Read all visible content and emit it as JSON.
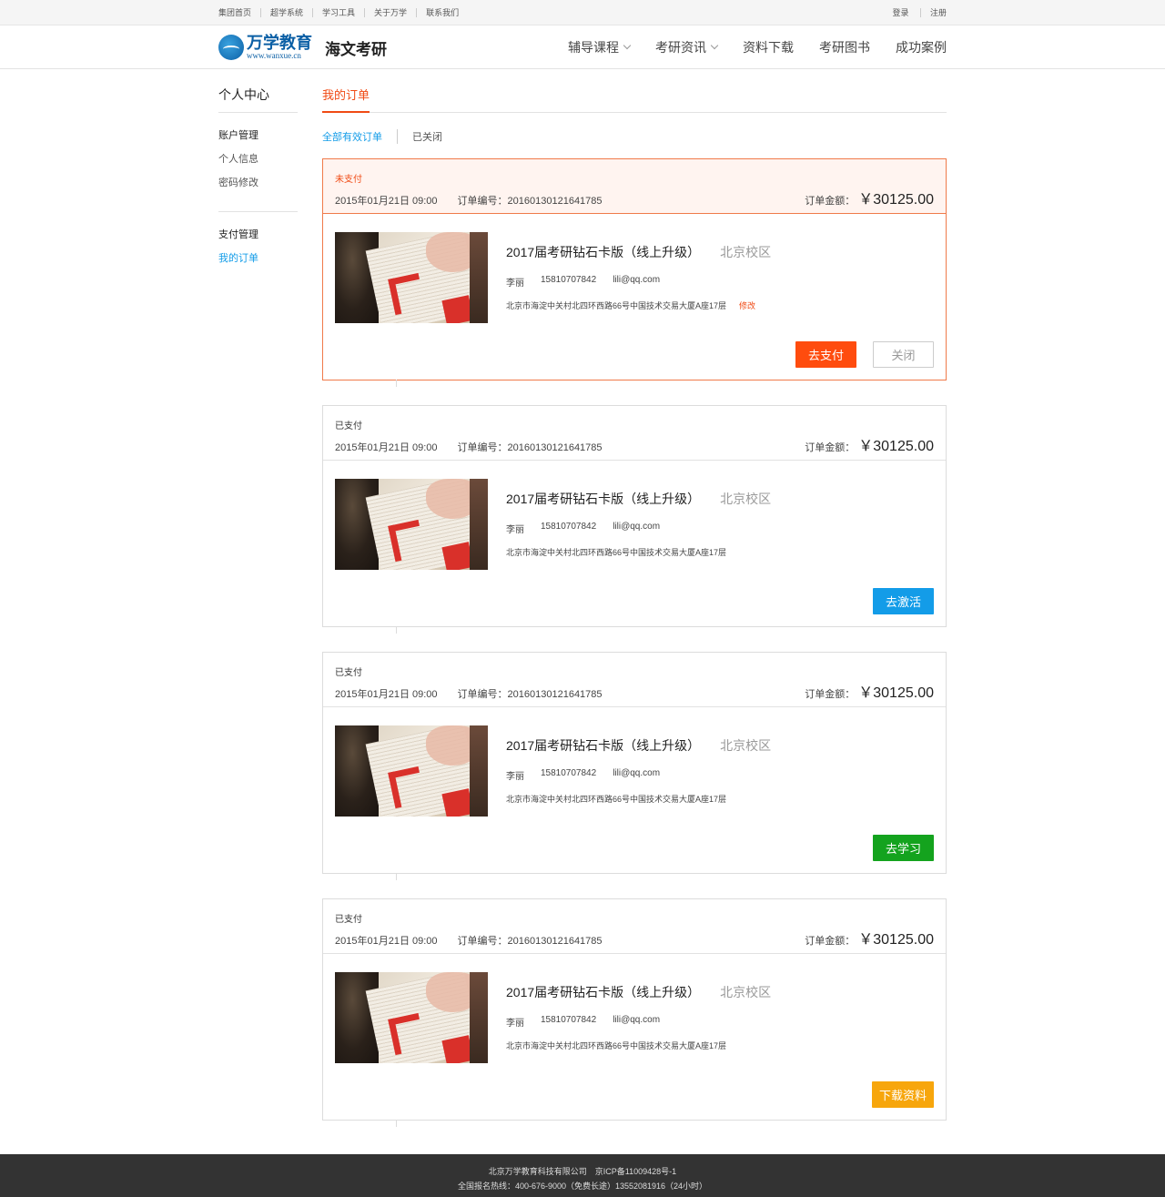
{
  "topbar": {
    "links": [
      "集团首页",
      "超学系统",
      "学习工具",
      "关于万学",
      "联系我们"
    ],
    "login": "登录",
    "register": "注册"
  },
  "header": {
    "logo_cn": "万学教育",
    "logo_en": "www.wanxue.cn",
    "brand_sub": "海文考研",
    "nav": [
      {
        "label": "辅导课程",
        "dropdown": true
      },
      {
        "label": "考研资讯",
        "dropdown": true
      },
      {
        "label": "资料下载",
        "dropdown": false
      },
      {
        "label": "考研图书",
        "dropdown": false
      },
      {
        "label": "成功案例",
        "dropdown": false
      }
    ]
  },
  "sidebar": {
    "title": "个人中心",
    "groups": [
      {
        "title": "账户管理",
        "items": [
          "个人信息",
          "密码修改"
        ]
      },
      {
        "title": "支付管理",
        "items": [
          "我的订单"
        ]
      }
    ],
    "active_item": "我的订单"
  },
  "main": {
    "tab": "我的订单",
    "filters": [
      "全部有效订单",
      "已关闭"
    ]
  },
  "orders": [
    {
      "status": "未支付",
      "date": "2015年01月21日 09:00",
      "order_no": "订单编号：20160130121641785",
      "amount_label": "订单金额：",
      "amount": "￥30125.00",
      "course": "2017届考研钻石卡版（线上升级）",
      "campus": "北京校区",
      "name": "李丽",
      "phone": "15810707842",
      "email": "lili@qq.com",
      "address": "北京市海淀中关村北四环西路66号中国技术交易大厦A座17层",
      "edit": "修改",
      "buttons": [
        {
          "label": "去支付",
          "style": "orange"
        },
        {
          "label": "关闭",
          "style": "ghost"
        }
      ]
    },
    {
      "status": "已支付",
      "date": "2015年01月21日 09:00",
      "order_no": "订单编号：20160130121641785",
      "amount_label": "订单金额：",
      "amount": "￥30125.00",
      "course": "2017届考研钻石卡版（线上升级）",
      "campus": "北京校区",
      "name": "李丽",
      "phone": "15810707842",
      "email": "lili@qq.com",
      "address": "北京市海淀中关村北四环西路66号中国技术交易大厦A座17层",
      "edit": "",
      "buttons": [
        {
          "label": "去激活",
          "style": "blue"
        }
      ]
    },
    {
      "status": "已支付",
      "date": "2015年01月21日 09:00",
      "order_no": "订单编号：20160130121641785",
      "amount_label": "订单金额：",
      "amount": "￥30125.00",
      "course": "2017届考研钻石卡版（线上升级）",
      "campus": "北京校区",
      "name": "李丽",
      "phone": "15810707842",
      "email": "lili@qq.com",
      "address": "北京市海淀中关村北四环西路66号中国技术交易大厦A座17层",
      "edit": "",
      "buttons": [
        {
          "label": "去学习",
          "style": "green"
        }
      ]
    },
    {
      "status": "已支付",
      "date": "2015年01月21日 09:00",
      "order_no": "订单编号：20160130121641785",
      "amount_label": "订单金额：",
      "amount": "￥30125.00",
      "course": "2017届考研钻石卡版（线上升级）",
      "campus": "北京校区",
      "name": "李丽",
      "phone": "15810707842",
      "email": "lili@qq.com",
      "address": "北京市海淀中关村北四环西路66号中国技术交易大厦A座17层",
      "edit": "",
      "buttons": [
        {
          "label": "下载资料",
          "style": "yellow"
        }
      ]
    }
  ],
  "footer": {
    "line1": "北京万学教育科技有限公司　京ICP备11009428号-1",
    "line2": "全国报名热线：400-676-9000（免费长途）13552081916（24小时）"
  },
  "colors": {
    "accent_orange": "#f04a14",
    "accent_blue": "#139ce8",
    "button_green": "#14a31e",
    "button_yellow": "#f7a60c",
    "footer_bg": "#333333"
  }
}
